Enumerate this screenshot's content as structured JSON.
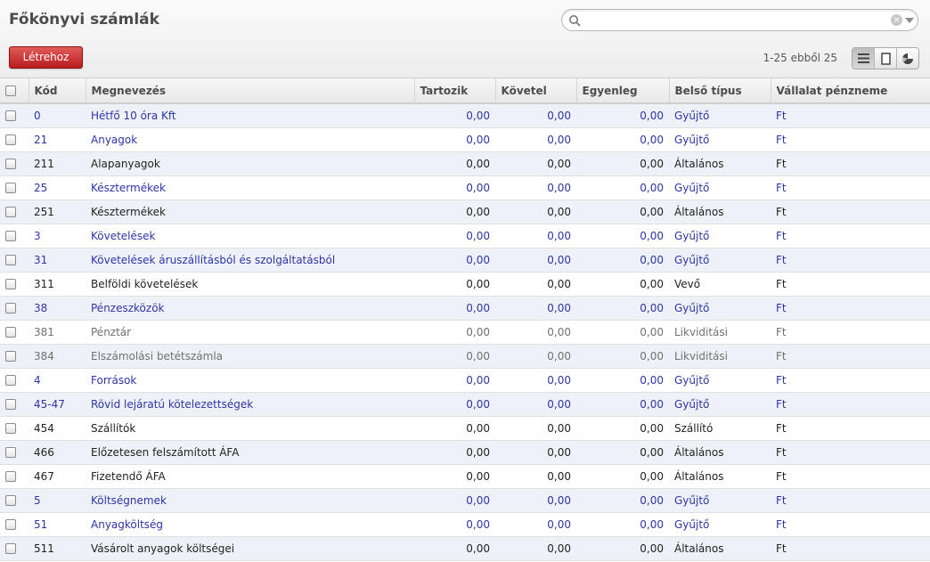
{
  "page": {
    "title": "Főkönyvi számlák"
  },
  "search": {
    "value": "",
    "placeholder": ""
  },
  "toolbar": {
    "create_label": "Létrehoz",
    "pager": "1-25 ebből 25"
  },
  "view_switch": [
    "list-view-icon",
    "form-view-icon",
    "graph-view-icon"
  ],
  "colors": {
    "link": "#2d35a8",
    "create": "#c62828",
    "muted": "#707070"
  },
  "table": {
    "headers": {
      "code": "Kód",
      "name": "Megnevezés",
      "debit": "Tartozik",
      "credit": "Követel",
      "balance": "Egyenleg",
      "type": "Belső típus",
      "currency": "Vállalat pénzneme"
    },
    "rows": [
      {
        "style": "view",
        "code": "0",
        "name": "Hétfő 10 óra Kft",
        "debit": "0,00",
        "credit": "0,00",
        "balance": "0,00",
        "type": "Gyűjtő",
        "currency": "Ft"
      },
      {
        "style": "view",
        "code": "21",
        "name": "Anyagok",
        "debit": "0,00",
        "credit": "0,00",
        "balance": "0,00",
        "type": "Gyűjtő",
        "currency": "Ft"
      },
      {
        "style": "normal",
        "code": "211",
        "name": "Alapanyagok",
        "debit": "0,00",
        "credit": "0,00",
        "balance": "0,00",
        "type": "Általános",
        "currency": "Ft"
      },
      {
        "style": "view",
        "code": "25",
        "name": "Késztermékek",
        "debit": "0,00",
        "credit": "0,00",
        "balance": "0,00",
        "type": "Gyűjtő",
        "currency": "Ft"
      },
      {
        "style": "normal",
        "code": "251",
        "name": "Késztermékek",
        "debit": "0,00",
        "credit": "0,00",
        "balance": "0,00",
        "type": "Általános",
        "currency": "Ft"
      },
      {
        "style": "view",
        "code": "3",
        "name": "Követelések",
        "debit": "0,00",
        "credit": "0,00",
        "balance": "0,00",
        "type": "Gyűjtő",
        "currency": "Ft"
      },
      {
        "style": "view",
        "code": "31",
        "name": "Követelések áruszállításból és szolgáltatásból",
        "debit": "0,00",
        "credit": "0,00",
        "balance": "0,00",
        "type": "Gyűjtő",
        "currency": "Ft"
      },
      {
        "style": "normal",
        "code": "311",
        "name": "Belföldi követelések",
        "debit": "0,00",
        "credit": "0,00",
        "balance": "0,00",
        "type": "Vevő",
        "currency": "Ft"
      },
      {
        "style": "view",
        "code": "38",
        "name": "Pénzeszközök",
        "debit": "0,00",
        "credit": "0,00",
        "balance": "0,00",
        "type": "Gyűjtő",
        "currency": "Ft"
      },
      {
        "style": "liq",
        "code": "381",
        "name": "Pénztár",
        "debit": "0,00",
        "credit": "0,00",
        "balance": "0,00",
        "type": "Likviditási",
        "currency": "Ft"
      },
      {
        "style": "liq",
        "code": "384",
        "name": "Elszámolási betétszámla",
        "debit": "0,00",
        "credit": "0,00",
        "balance": "0,00",
        "type": "Likviditási",
        "currency": "Ft"
      },
      {
        "style": "view",
        "code": "4",
        "name": "Források",
        "debit": "0,00",
        "credit": "0,00",
        "balance": "0,00",
        "type": "Gyűjtő",
        "currency": "Ft"
      },
      {
        "style": "view",
        "code": "45-47",
        "name": "Rövid lejáratú kötelezettségek",
        "debit": "0,00",
        "credit": "0,00",
        "balance": "0,00",
        "type": "Gyűjtő",
        "currency": "Ft"
      },
      {
        "style": "normal",
        "code": "454",
        "name": "Szállítók",
        "debit": "0,00",
        "credit": "0,00",
        "balance": "0,00",
        "type": "Szállító",
        "currency": "Ft"
      },
      {
        "style": "normal",
        "code": "466",
        "name": "Előzetesen felszámított ÁFA",
        "debit": "0,00",
        "credit": "0,00",
        "balance": "0,00",
        "type": "Általános",
        "currency": "Ft"
      },
      {
        "style": "normal",
        "code": "467",
        "name": "Fizetendő ÁFA",
        "debit": "0,00",
        "credit": "0,00",
        "balance": "0,00",
        "type": "Általános",
        "currency": "Ft"
      },
      {
        "style": "view",
        "code": "5",
        "name": "Költségnemek",
        "debit": "0,00",
        "credit": "0,00",
        "balance": "0,00",
        "type": "Gyűjtő",
        "currency": "Ft"
      },
      {
        "style": "view",
        "code": "51",
        "name": "Anyagköltség",
        "debit": "0,00",
        "credit": "0,00",
        "balance": "0,00",
        "type": "Gyűjtő",
        "currency": "Ft"
      },
      {
        "style": "normal",
        "code": "511",
        "name": "Vásárolt anyagok költségei",
        "debit": "0,00",
        "credit": "0,00",
        "balance": "0,00",
        "type": "Általános",
        "currency": "Ft"
      }
    ]
  }
}
